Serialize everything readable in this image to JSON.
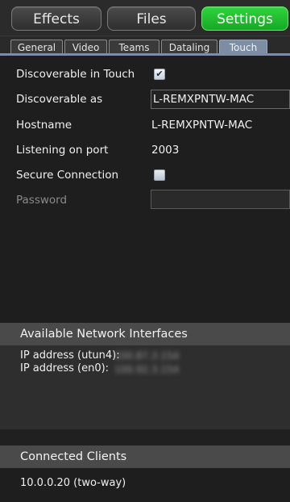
{
  "top_tabs": {
    "effects": "Effects",
    "files": "Files",
    "settings": "Settings"
  },
  "sub_tabs": [
    "General",
    "Video",
    "Teams",
    "Dataling",
    "Touch"
  ],
  "touch": {
    "discoverable_label": "Discoverable in Touch",
    "discoverable_checked": "✔",
    "discoverable_as_label": "Discoverable as",
    "discoverable_as_value": "L-REMXPNTW-MAC",
    "hostname_label": "Hostname",
    "hostname_value": "L-REMXPNTW-MAC",
    "port_label": "Listening on port",
    "port_value": "2003",
    "secure_label": "Secure Connection",
    "password_label": "Password",
    "password_value": ""
  },
  "interfaces": {
    "header": "Available Network Interfaces",
    "items": [
      {
        "label": "IP address (utun4):",
        "value": "100.87.3.154"
      },
      {
        "label": "IP address (en0):",
        "value": "100.92.3.154"
      }
    ]
  },
  "clients": {
    "header": "Connected Clients",
    "items": [
      "10.0.0.20 (two-way)"
    ]
  },
  "colors": {
    "accent_green": "#22c233",
    "active_tab": "#7d8da3",
    "background": "#1e1e1e"
  }
}
